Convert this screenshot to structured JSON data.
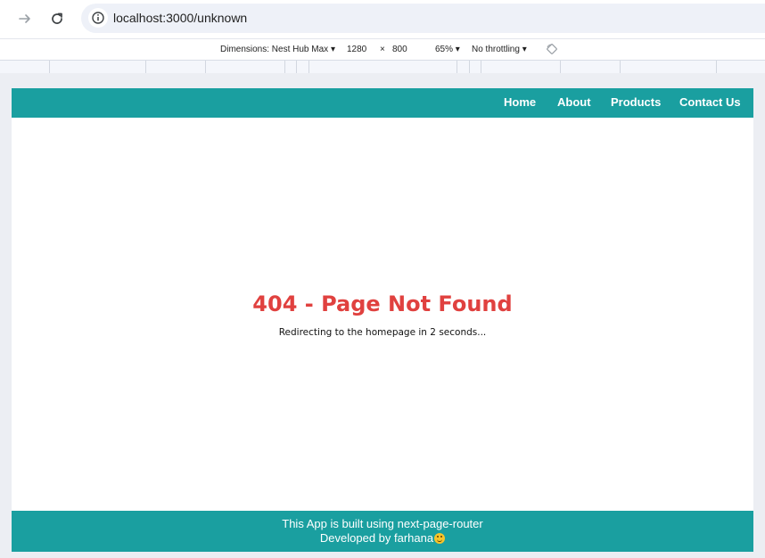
{
  "browser": {
    "url": "localhost:3000/unknown",
    "icons": [
      "forward-arrow-icon",
      "reload-icon",
      "info-icon"
    ]
  },
  "device_toolbar": {
    "dimensions_label": "Dimensions: Nest Hub Max",
    "width": "1280",
    "times": "×",
    "height": "800",
    "zoom": "65%",
    "throttling": "No throttling"
  },
  "site": {
    "nav": {
      "home": "Home",
      "about": "About",
      "products": "Products",
      "contact": "Contact Us"
    },
    "main": {
      "title": "404 - Page Not Found",
      "message": "Redirecting to the homepage in 2 seconds..."
    },
    "footer": {
      "line1": "This App is built using next-page-router",
      "line2": "Developed by farhana"
    },
    "colors": {
      "nav_bg": "#1a9fa0",
      "error_text": "#e0413f"
    }
  }
}
